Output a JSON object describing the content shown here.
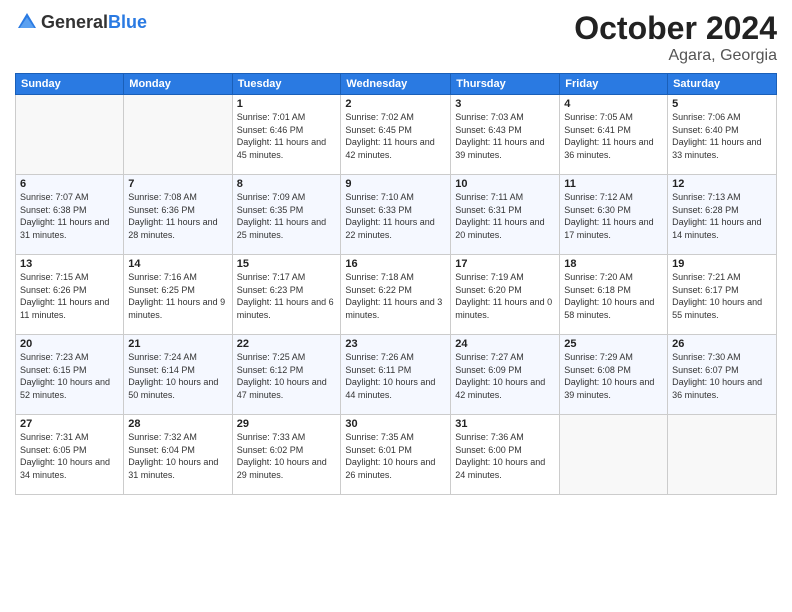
{
  "header": {
    "logo": {
      "general": "General",
      "blue": "Blue"
    },
    "month": "October 2024",
    "location": "Agara, Georgia"
  },
  "weekdays": [
    "Sunday",
    "Monday",
    "Tuesday",
    "Wednesday",
    "Thursday",
    "Friday",
    "Saturday"
  ],
  "weeks": [
    [
      {
        "day": "",
        "sunrise": "",
        "sunset": "",
        "daylight": ""
      },
      {
        "day": "",
        "sunrise": "",
        "sunset": "",
        "daylight": ""
      },
      {
        "day": "1",
        "sunrise": "Sunrise: 7:01 AM",
        "sunset": "Sunset: 6:46 PM",
        "daylight": "Daylight: 11 hours and 45 minutes."
      },
      {
        "day": "2",
        "sunrise": "Sunrise: 7:02 AM",
        "sunset": "Sunset: 6:45 PM",
        "daylight": "Daylight: 11 hours and 42 minutes."
      },
      {
        "day": "3",
        "sunrise": "Sunrise: 7:03 AM",
        "sunset": "Sunset: 6:43 PM",
        "daylight": "Daylight: 11 hours and 39 minutes."
      },
      {
        "day": "4",
        "sunrise": "Sunrise: 7:05 AM",
        "sunset": "Sunset: 6:41 PM",
        "daylight": "Daylight: 11 hours and 36 minutes."
      },
      {
        "day": "5",
        "sunrise": "Sunrise: 7:06 AM",
        "sunset": "Sunset: 6:40 PM",
        "daylight": "Daylight: 11 hours and 33 minutes."
      }
    ],
    [
      {
        "day": "6",
        "sunrise": "Sunrise: 7:07 AM",
        "sunset": "Sunset: 6:38 PM",
        "daylight": "Daylight: 11 hours and 31 minutes."
      },
      {
        "day": "7",
        "sunrise": "Sunrise: 7:08 AM",
        "sunset": "Sunset: 6:36 PM",
        "daylight": "Daylight: 11 hours and 28 minutes."
      },
      {
        "day": "8",
        "sunrise": "Sunrise: 7:09 AM",
        "sunset": "Sunset: 6:35 PM",
        "daylight": "Daylight: 11 hours and 25 minutes."
      },
      {
        "day": "9",
        "sunrise": "Sunrise: 7:10 AM",
        "sunset": "Sunset: 6:33 PM",
        "daylight": "Daylight: 11 hours and 22 minutes."
      },
      {
        "day": "10",
        "sunrise": "Sunrise: 7:11 AM",
        "sunset": "Sunset: 6:31 PM",
        "daylight": "Daylight: 11 hours and 20 minutes."
      },
      {
        "day": "11",
        "sunrise": "Sunrise: 7:12 AM",
        "sunset": "Sunset: 6:30 PM",
        "daylight": "Daylight: 11 hours and 17 minutes."
      },
      {
        "day": "12",
        "sunrise": "Sunrise: 7:13 AM",
        "sunset": "Sunset: 6:28 PM",
        "daylight": "Daylight: 11 hours and 14 minutes."
      }
    ],
    [
      {
        "day": "13",
        "sunrise": "Sunrise: 7:15 AM",
        "sunset": "Sunset: 6:26 PM",
        "daylight": "Daylight: 11 hours and 11 minutes."
      },
      {
        "day": "14",
        "sunrise": "Sunrise: 7:16 AM",
        "sunset": "Sunset: 6:25 PM",
        "daylight": "Daylight: 11 hours and 9 minutes."
      },
      {
        "day": "15",
        "sunrise": "Sunrise: 7:17 AM",
        "sunset": "Sunset: 6:23 PM",
        "daylight": "Daylight: 11 hours and 6 minutes."
      },
      {
        "day": "16",
        "sunrise": "Sunrise: 7:18 AM",
        "sunset": "Sunset: 6:22 PM",
        "daylight": "Daylight: 11 hours and 3 minutes."
      },
      {
        "day": "17",
        "sunrise": "Sunrise: 7:19 AM",
        "sunset": "Sunset: 6:20 PM",
        "daylight": "Daylight: 11 hours and 0 minutes."
      },
      {
        "day": "18",
        "sunrise": "Sunrise: 7:20 AM",
        "sunset": "Sunset: 6:18 PM",
        "daylight": "Daylight: 10 hours and 58 minutes."
      },
      {
        "day": "19",
        "sunrise": "Sunrise: 7:21 AM",
        "sunset": "Sunset: 6:17 PM",
        "daylight": "Daylight: 10 hours and 55 minutes."
      }
    ],
    [
      {
        "day": "20",
        "sunrise": "Sunrise: 7:23 AM",
        "sunset": "Sunset: 6:15 PM",
        "daylight": "Daylight: 10 hours and 52 minutes."
      },
      {
        "day": "21",
        "sunrise": "Sunrise: 7:24 AM",
        "sunset": "Sunset: 6:14 PM",
        "daylight": "Daylight: 10 hours and 50 minutes."
      },
      {
        "day": "22",
        "sunrise": "Sunrise: 7:25 AM",
        "sunset": "Sunset: 6:12 PM",
        "daylight": "Daylight: 10 hours and 47 minutes."
      },
      {
        "day": "23",
        "sunrise": "Sunrise: 7:26 AM",
        "sunset": "Sunset: 6:11 PM",
        "daylight": "Daylight: 10 hours and 44 minutes."
      },
      {
        "day": "24",
        "sunrise": "Sunrise: 7:27 AM",
        "sunset": "Sunset: 6:09 PM",
        "daylight": "Daylight: 10 hours and 42 minutes."
      },
      {
        "day": "25",
        "sunrise": "Sunrise: 7:29 AM",
        "sunset": "Sunset: 6:08 PM",
        "daylight": "Daylight: 10 hours and 39 minutes."
      },
      {
        "day": "26",
        "sunrise": "Sunrise: 7:30 AM",
        "sunset": "Sunset: 6:07 PM",
        "daylight": "Daylight: 10 hours and 36 minutes."
      }
    ],
    [
      {
        "day": "27",
        "sunrise": "Sunrise: 7:31 AM",
        "sunset": "Sunset: 6:05 PM",
        "daylight": "Daylight: 10 hours and 34 minutes."
      },
      {
        "day": "28",
        "sunrise": "Sunrise: 7:32 AM",
        "sunset": "Sunset: 6:04 PM",
        "daylight": "Daylight: 10 hours and 31 minutes."
      },
      {
        "day": "29",
        "sunrise": "Sunrise: 7:33 AM",
        "sunset": "Sunset: 6:02 PM",
        "daylight": "Daylight: 10 hours and 29 minutes."
      },
      {
        "day": "30",
        "sunrise": "Sunrise: 7:35 AM",
        "sunset": "Sunset: 6:01 PM",
        "daylight": "Daylight: 10 hours and 26 minutes."
      },
      {
        "day": "31",
        "sunrise": "Sunrise: 7:36 AM",
        "sunset": "Sunset: 6:00 PM",
        "daylight": "Daylight: 10 hours and 24 minutes."
      },
      {
        "day": "",
        "sunrise": "",
        "sunset": "",
        "daylight": ""
      },
      {
        "day": "",
        "sunrise": "",
        "sunset": "",
        "daylight": ""
      }
    ]
  ]
}
